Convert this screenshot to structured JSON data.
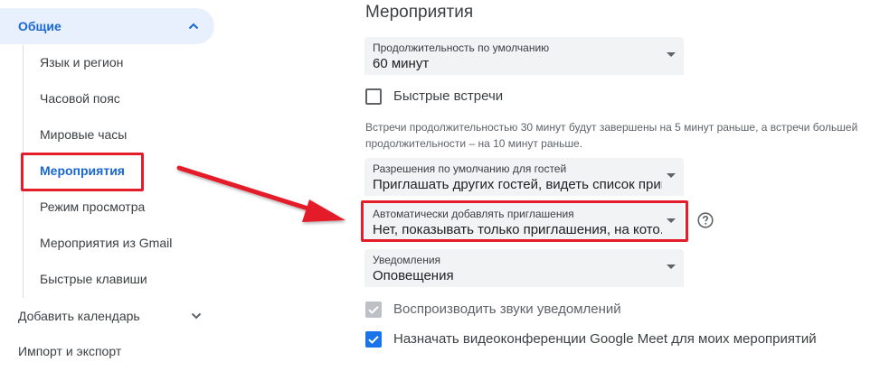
{
  "sidebar": {
    "general": {
      "label": "Общие"
    },
    "subitems": [
      {
        "label": "Язык и регион"
      },
      {
        "label": "Часовой пояс"
      },
      {
        "label": "Мировые часы"
      },
      {
        "label": "Мероприятия"
      },
      {
        "label": "Режим просмотра"
      },
      {
        "label": "Мероприятия из Gmail"
      },
      {
        "label": "Быстрые клавиши"
      }
    ],
    "add_calendar": {
      "label": "Добавить календарь"
    },
    "import_export": {
      "label": "Импорт и экспорт"
    }
  },
  "main": {
    "title": "Мероприятия",
    "default_duration": {
      "label": "Продолжительность по умолчанию",
      "value": "60 минут"
    },
    "speedy_meetings": {
      "label": "Быстрые встречи",
      "checked": false
    },
    "speedy_hint": "Встречи продолжительностью 30 минут будут завершены на 5 минут раньше, а встречи большей продолжительности – на 10 минут раньше.",
    "guest_permissions": {
      "label": "Разрешения по умолчанию для гостей",
      "value": "Приглашать других гостей, видеть список пригл..."
    },
    "auto_add_invites": {
      "label": "Автоматически добавлять приглашения",
      "value": "Нет, показывать только приглашения, на кото..."
    },
    "notifications": {
      "label": "Уведомления",
      "value": "Оповещения"
    },
    "play_sounds": {
      "label": "Воспроизводить звуки уведомлений",
      "checked": true,
      "disabled": true
    },
    "meet_conferences": {
      "label": "Назначать видеоконференции Google Meet для моих мероприятий",
      "checked": true
    }
  },
  "colors": {
    "accent": "#1a73e8",
    "selected_bg": "#e8f0fe",
    "annotation": "#e41d2a"
  }
}
